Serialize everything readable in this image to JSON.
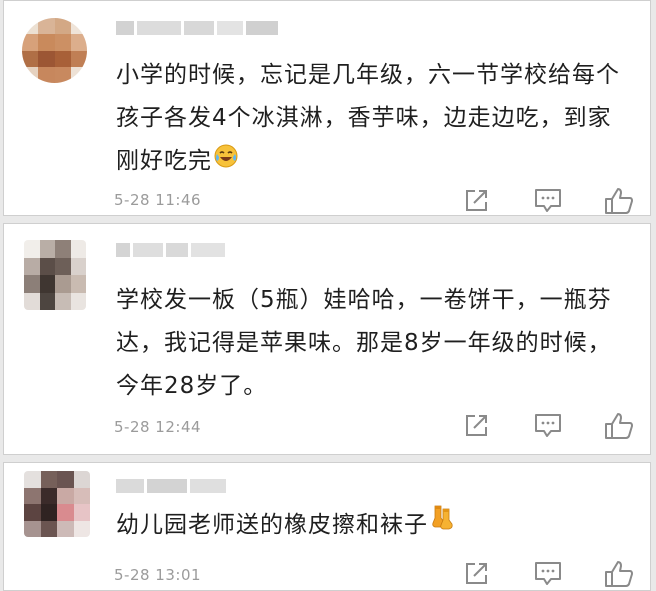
{
  "comments": [
    {
      "text": "小学的时候，忘记是几年级，六一节学校给每个孩子各发4个冰淇淋，香芋味，边走边吃，到家刚好吃完",
      "emoji": "laugh-cry-emoji",
      "time": "5-28  11:46"
    },
    {
      "text": "学校发一板（5瓶）娃哈哈，一卷饼干，一瓶芬达，我记得是苹果味。那是8岁一年级的时候，今年28岁了。",
      "time": "5-28  12:44"
    },
    {
      "text": "幼儿园老师送的橡皮擦和袜子",
      "emoji": "socks-emoji",
      "time": "5-28  13:01"
    }
  ],
  "actions": {
    "share_icon": "share-icon",
    "reply_icon": "comment-icon",
    "like_icon": "thumbs-up-icon"
  },
  "colors": {
    "text": "#1f1f1f",
    "meta": "#9b9b9b",
    "icon": "#8a8a8a",
    "card": "#ffffff",
    "separator": "#e9e9e9"
  }
}
